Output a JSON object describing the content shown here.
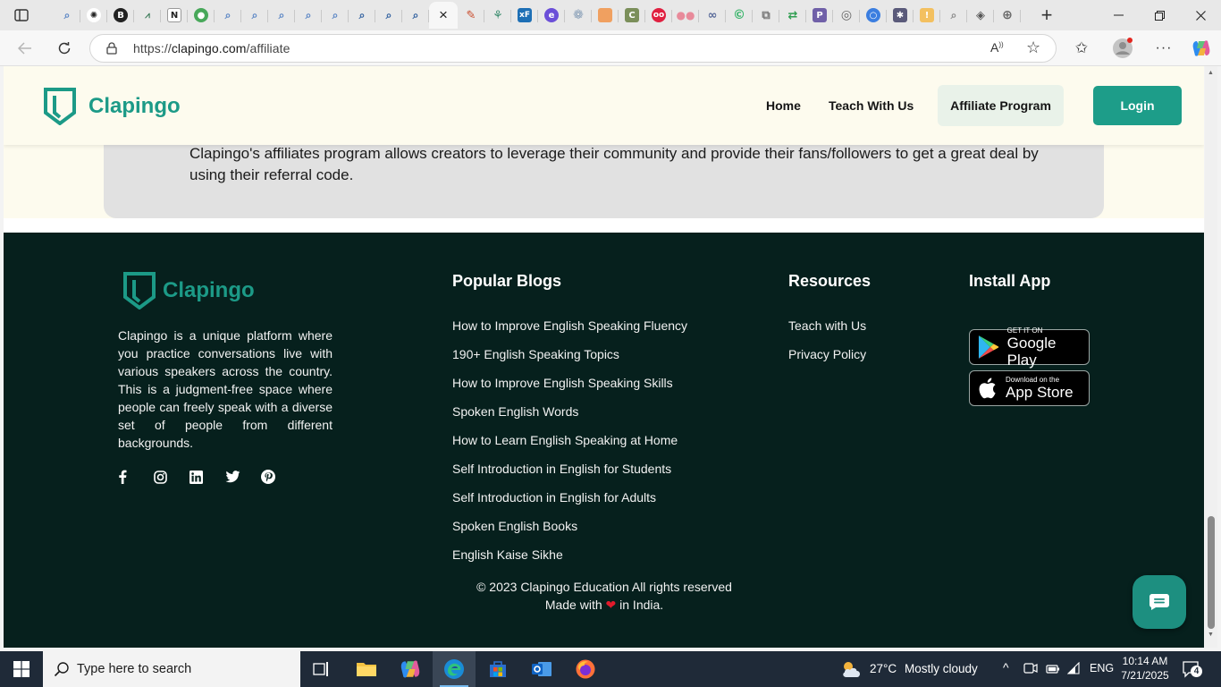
{
  "browser": {
    "tabs_count_hint": "many",
    "active_tab_close_glyph": "×",
    "new_tab_glyph": "+",
    "url_scheme": "https://",
    "url_host": "clapingo.com",
    "url_path": "/affiliate",
    "window_controls": {
      "minimize": "—",
      "restore": "❐",
      "close": "✕"
    }
  },
  "site": {
    "brand_name": "Clapingo",
    "brand_color": "#1c9a87",
    "nav": {
      "home": "Home",
      "teach": "Teach With Us",
      "affiliate": "Affiliate Program",
      "login": "Login"
    },
    "hero_text_partial": "Clapingo's affiliates program allows creators to leverage their community and provide their fans/followers to get a great",
    "hero_text_line2": "deal by using their referral code."
  },
  "footer": {
    "brand_name": "Clapingo",
    "about": "Clapingo is a unique platform where you practice conversations live with various speakers across the country. This is a judgment-free space where people can freely speak with a diverse set of people from different backgrounds.",
    "socials": [
      "facebook-icon",
      "instagram-icon",
      "linkedin-icon",
      "twitter-icon",
      "pinterest-icon"
    ],
    "blogs_title": "Popular Blogs",
    "blogs": [
      "How to Improve English Speaking Fluency",
      "190+ English Speaking Topics",
      "How to Improve English Speaking Skills",
      "Spoken English Words",
      "How to Learn English Speaking at Home",
      "Self Introduction in English for Students",
      "Self Introduction in English for Adults",
      "Spoken English Books",
      "English Kaise Sikhe"
    ],
    "resources_title": "Resources",
    "resources": [
      "Teach with Us",
      "Privacy Policy"
    ],
    "install_title": "Install App",
    "google_play": {
      "small": "GET IT ON",
      "big": "Google Play"
    },
    "app_store": {
      "small": "Download on the",
      "big": "App Store"
    },
    "copyright_line1": "© 2023 Clapingo Education All rights reserved",
    "copyright_made": "Made with",
    "copyright_heart": "❤",
    "copyright_in": "in India."
  },
  "taskbar": {
    "search_placeholder": "Type here to search",
    "weather_temp": "27°C",
    "weather_desc": "Mostly cloudy",
    "language": "ENG",
    "time": "10:14 AM",
    "date": "7/21/2025",
    "notifications": "4"
  }
}
